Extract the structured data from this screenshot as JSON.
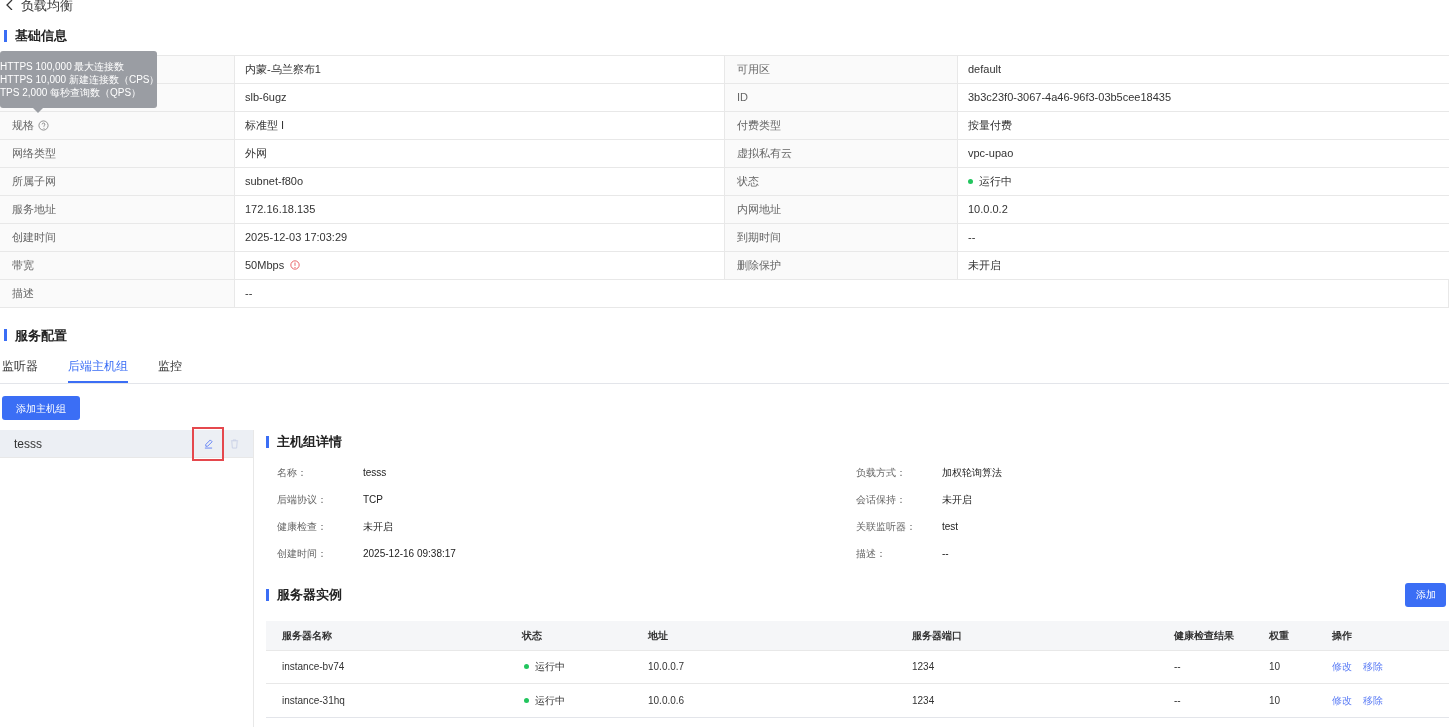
{
  "page": {
    "title": "负载均衡"
  },
  "basic_info": {
    "title": "基础信息",
    "tooltip": {
      "lines": [
        "HTTPS 100,000 最大连接数",
        "HTTPS 10,000 新建连接数（CPS）",
        "TPS 2,000 每秒查询数（QPS）"
      ]
    },
    "rows": [
      [
        {
          "value": "内蒙-乌兰察布1"
        },
        {
          "label": "可用区",
          "value": "default"
        }
      ],
      [
        {
          "value": "slb-6ugz"
        },
        {
          "label": "ID",
          "value": "3b3c23f0-3067-4a46-96f3-03b5cee18435"
        }
      ],
      [
        {
          "label": "规格",
          "help_icon": true,
          "value": "标准型 I"
        },
        {
          "label": "付费类型",
          "value": "按量付费"
        }
      ],
      [
        {
          "label": "网络类型",
          "value": "外网"
        },
        {
          "label": "虚拟私有云",
          "value": "vpc-upao"
        }
      ],
      [
        {
          "label": "所属子网",
          "value": "subnet-f80o"
        },
        {
          "label": "状态",
          "value": "运行中",
          "color": "#22c55e"
        }
      ],
      [
        {
          "label": "服务地址",
          "value": "172.16.18.135"
        },
        {
          "label": "内网地址",
          "value": "10.0.0.2"
        }
      ],
      [
        {
          "label": "创建时间",
          "value": "2025-12-03 17:03:29"
        },
        {
          "label": "到期时间",
          "value": "--"
        }
      ],
      [
        {
          "label": "带宽",
          "value": "50Mbps",
          "warning_icon": true
        },
        {
          "label": "删除保护",
          "value": "未开启"
        }
      ],
      [
        {
          "label": "描述",
          "value": "--"
        }
      ]
    ]
  },
  "service_config": {
    "title": "服务配置",
    "tabs": [
      {
        "label": "监听器",
        "selected": false
      },
      {
        "label": "后端主机组",
        "selected": true
      },
      {
        "label": "监控",
        "selected": false
      }
    ],
    "add_group_button": "添加主机组",
    "groups": [
      {
        "name": "tesss",
        "selected": true,
        "edit_highlighted": true
      }
    ],
    "group_detail": {
      "title": "主机组详情",
      "left": [
        {
          "label": "名称：",
          "value": "tesss"
        },
        {
          "label": "后端协议：",
          "value": "TCP"
        },
        {
          "label": "健康检查：",
          "value": "未开启"
        },
        {
          "label": "创建时间：",
          "value": "2025-12-16 09:38:17"
        }
      ],
      "right": [
        {
          "label": "负载方式：",
          "value": "加权轮询算法"
        },
        {
          "label": "会话保持：",
          "value": "未开启"
        },
        {
          "label": "关联监听器：",
          "value": "test"
        },
        {
          "label": "描述：",
          "value": "--"
        }
      ]
    },
    "servers": {
      "title": "服务器实例",
      "add_button": "添加",
      "columns": [
        "服务器名称",
        "状态",
        "地址",
        "服务器端口",
        "健康检查结果",
        "权重",
        "操作"
      ],
      "rows": [
        {
          "name": "instance-bv74",
          "status": "运行中",
          "color": "#22c55e",
          "address": "10.0.0.7",
          "port": "1234",
          "health": "--",
          "weight": "10",
          "actions": [
            "修改",
            "移除"
          ]
        },
        {
          "name": "instance-31hq",
          "status": "运行中",
          "color": "#22c55e",
          "address": "10.0.0.6",
          "port": "1234",
          "health": "--",
          "weight": "10",
          "actions": [
            "修改",
            "移除"
          ]
        }
      ]
    }
  }
}
